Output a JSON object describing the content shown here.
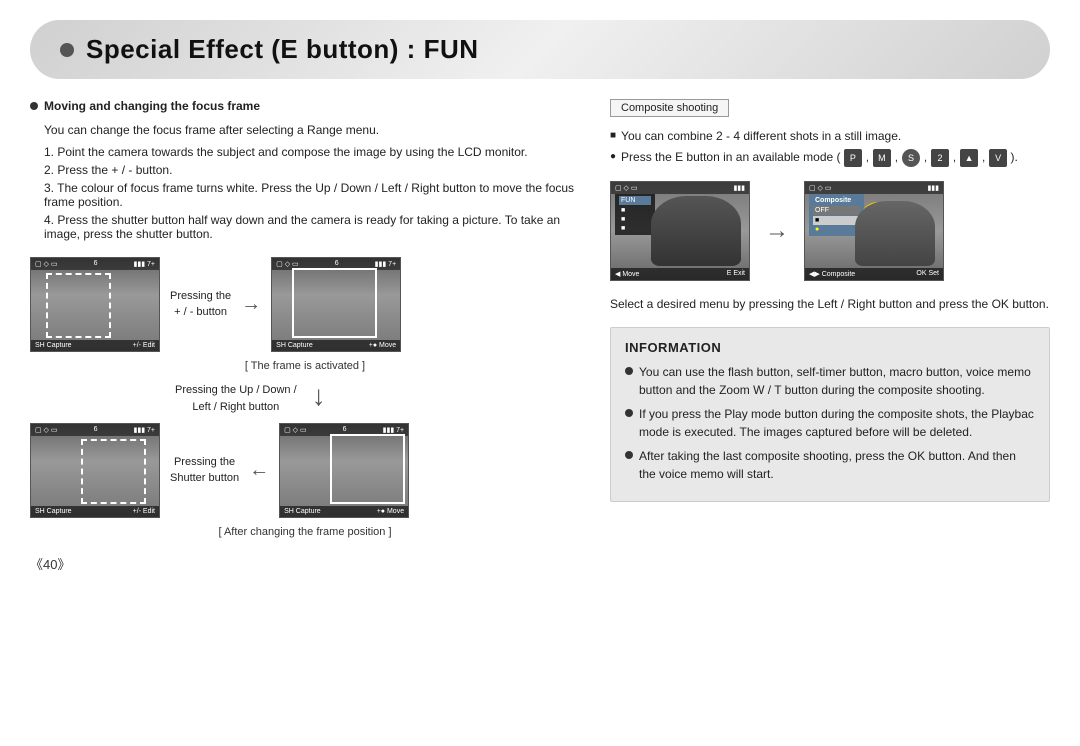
{
  "header": {
    "title": "Special Effect (E button) : FUN"
  },
  "left": {
    "focus_title": "Moving and changing the focus frame",
    "focus_sub": "You can change the focus frame after selecting a Range menu.",
    "steps": [
      "1. Point the camera towards the subject and compose the image by using the LCD monitor.",
      "2. Press the + / - button.",
      "3. The colour of focus frame turns white. Press the Up / Down / Left / Right button to move the focus frame position.",
      "4. Press the shutter button half way down and the camera is ready for taking a picture. To take an image, press the shutter button."
    ],
    "pressing_plus": "Pressing the\n+ / - button",
    "frame_activated": "[ The frame is activated ]",
    "pressing_updown": "Pressing the Up / Down /\nLeft / Right button",
    "pressing_shutter": "Pressing the\nShutter button",
    "after_changing": "[ After changing the frame position ]",
    "cam_labels": {
      "sh_capture": "SH  Capture",
      "edit": "+/-  Edit",
      "move": "+●  Move"
    }
  },
  "right": {
    "composite_tag": "Composite shooting",
    "line1": "■  You can combine 2 - 4 different shots in a still image.",
    "line2_prefix": "●  Press the E button in an available mode (",
    "line2_suffix": ").",
    "mode_icons": [
      "P",
      "M",
      "S",
      "2",
      "A",
      "V"
    ],
    "select_text": "Select a desired menu by pressing the Left / Right button and press the OK button.",
    "info": {
      "title": "INFORMATION",
      "items": [
        "You can use the flash button, self-timer button, macro button, voice memo button and the Zoom W / T button during the composite shooting.",
        "If you press the Play mode button during the composite shots, the Playbac mode is executed. The images captured before will be deleted.",
        "After taking the last composite shooting, press the OK button. And then the voice memo will start."
      ]
    }
  },
  "page_number": "《40》"
}
